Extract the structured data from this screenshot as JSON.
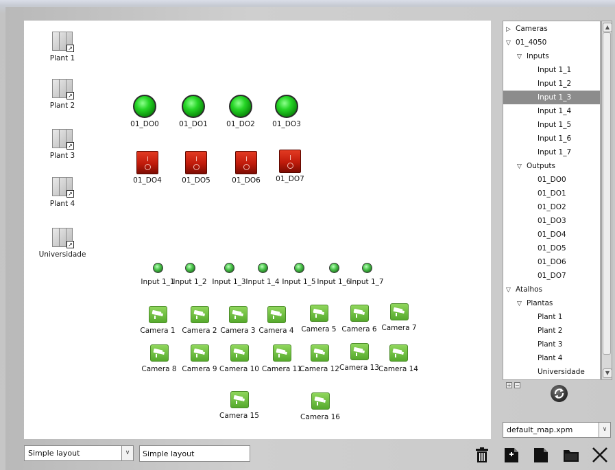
{
  "maps": [
    {
      "label": "Plant 1"
    },
    {
      "label": "Plant 2"
    },
    {
      "label": "Plant 3"
    },
    {
      "label": "Plant 4"
    },
    {
      "label": "Universidade"
    }
  ],
  "digital_outputs_on": [
    {
      "label": "01_DO0"
    },
    {
      "label": "01_DO1"
    },
    {
      "label": "01_DO2"
    },
    {
      "label": "01_DO3"
    }
  ],
  "digital_outputs_off": [
    {
      "label": "01_DO4"
    },
    {
      "label": "01_DO5"
    },
    {
      "label": "01_DO6"
    },
    {
      "label": "01_DO7"
    }
  ],
  "inputs": [
    {
      "label": "Input 1_1"
    },
    {
      "label": "Input 1_2"
    },
    {
      "label": "Input 1_3"
    },
    {
      "label": "Input 1_4"
    },
    {
      "label": "Input 1_5"
    },
    {
      "label": "Input 1_6"
    },
    {
      "label": "Input 1_7"
    }
  ],
  "cameras": [
    {
      "label": "Camera 1"
    },
    {
      "label": "Camera 2"
    },
    {
      "label": "Camera 3"
    },
    {
      "label": "Camera 4"
    },
    {
      "label": "Camera 5"
    },
    {
      "label": "Camera 6"
    },
    {
      "label": "Camera 7"
    },
    {
      "label": "Camera 8"
    },
    {
      "label": "Camera 9"
    },
    {
      "label": "Camera 10"
    },
    {
      "label": "Camera 11"
    },
    {
      "label": "Camera 12"
    },
    {
      "label": "Camera 13"
    },
    {
      "label": "Camera 14"
    },
    {
      "label": "Camera 15"
    },
    {
      "label": "Camera 16"
    }
  ],
  "tree": [
    {
      "label": "Cameras",
      "expander": "collapsed"
    },
    {
      "label": "01_4050",
      "expander": "expanded"
    },
    {
      "label": "Inputs",
      "expander": "expanded"
    },
    {
      "label": "Input 1_1"
    },
    {
      "label": "Input 1_2"
    },
    {
      "label": "Input 1_3",
      "selected": true
    },
    {
      "label": "Input 1_4"
    },
    {
      "label": "Input 1_5"
    },
    {
      "label": "Input 1_6"
    },
    {
      "label": "Input 1_7"
    },
    {
      "label": "Outputs",
      "expander": "expanded"
    },
    {
      "label": "01_DO0"
    },
    {
      "label": "01_DO1"
    },
    {
      "label": "01_DO2"
    },
    {
      "label": "01_DO3"
    },
    {
      "label": "01_DO4"
    },
    {
      "label": "01_DO5"
    },
    {
      "label": "01_DO6"
    },
    {
      "label": "01_DO7"
    },
    {
      "label": "Atalhos",
      "expander": "expanded"
    },
    {
      "label": "Plantas",
      "expander": "expanded"
    },
    {
      "label": "Plant 1"
    },
    {
      "label": "Plant 2"
    },
    {
      "label": "Plant 3"
    },
    {
      "label": "Plant 4"
    },
    {
      "label": "Universidade"
    }
  ],
  "map_file_select": {
    "value": "default_map.xpm"
  },
  "layout_select": {
    "value": "Simple layout"
  },
  "layout_name_input": {
    "value": "Simple layout"
  },
  "toolbar": {
    "icons": [
      "trash-icon",
      "new-file-icon",
      "file-icon",
      "folder-icon",
      "close-icon"
    ]
  },
  "colors": {
    "canvas_bg": "#ffffff",
    "selected_row": "#8c8c8c",
    "output_on": "#26d626",
    "output_off": "#c01b0b",
    "camera": "#6abb3a"
  }
}
